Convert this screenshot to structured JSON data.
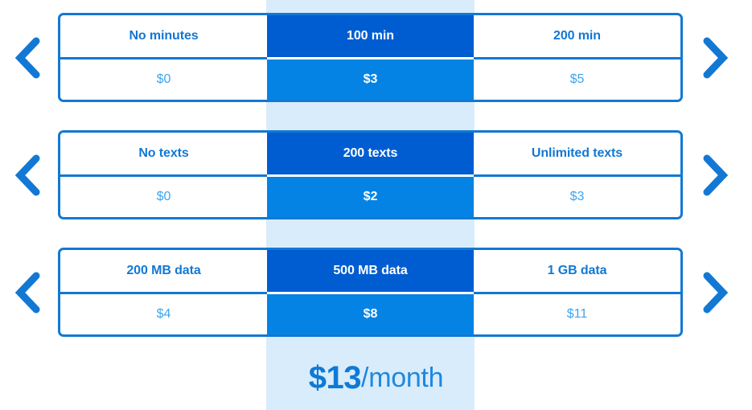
{
  "theme": {
    "accent": "#1278d4",
    "selected_option_bg": "#005dd1",
    "selected_price_bg": "#0583e4",
    "highlight_band": "#d8ecfb",
    "price_text": "#3da5ef",
    "card_bg": "#ffffff",
    "page_bg": "#ffffff"
  },
  "controls": {
    "prev_label": "Previous option",
    "next_label": "Next option",
    "prev_icon": "chevron-left-icon",
    "next_icon": "chevron-right-icon"
  },
  "rows": [
    {
      "id": "minutes",
      "options": [
        {
          "label": "No minutes",
          "price": "$0",
          "selected": false
        },
        {
          "label": "100 min",
          "price": "$3",
          "selected": true
        },
        {
          "label": "200 min",
          "price": "$5",
          "selected": false
        }
      ]
    },
    {
      "id": "texts",
      "options": [
        {
          "label": "No texts",
          "price": "$0",
          "selected": false
        },
        {
          "label": "200 texts",
          "price": "$2",
          "selected": true
        },
        {
          "label": "Unlimited texts",
          "price": "$3",
          "selected": false
        }
      ]
    },
    {
      "id": "data",
      "options": [
        {
          "label": "200 MB data",
          "price": "$4",
          "selected": false
        },
        {
          "label": "500 MB data",
          "price": "$8",
          "selected": true
        },
        {
          "label": "1 GB data",
          "price": "$11",
          "selected": false
        }
      ]
    }
  ],
  "total": {
    "amount": "$13",
    "period": "/month"
  }
}
